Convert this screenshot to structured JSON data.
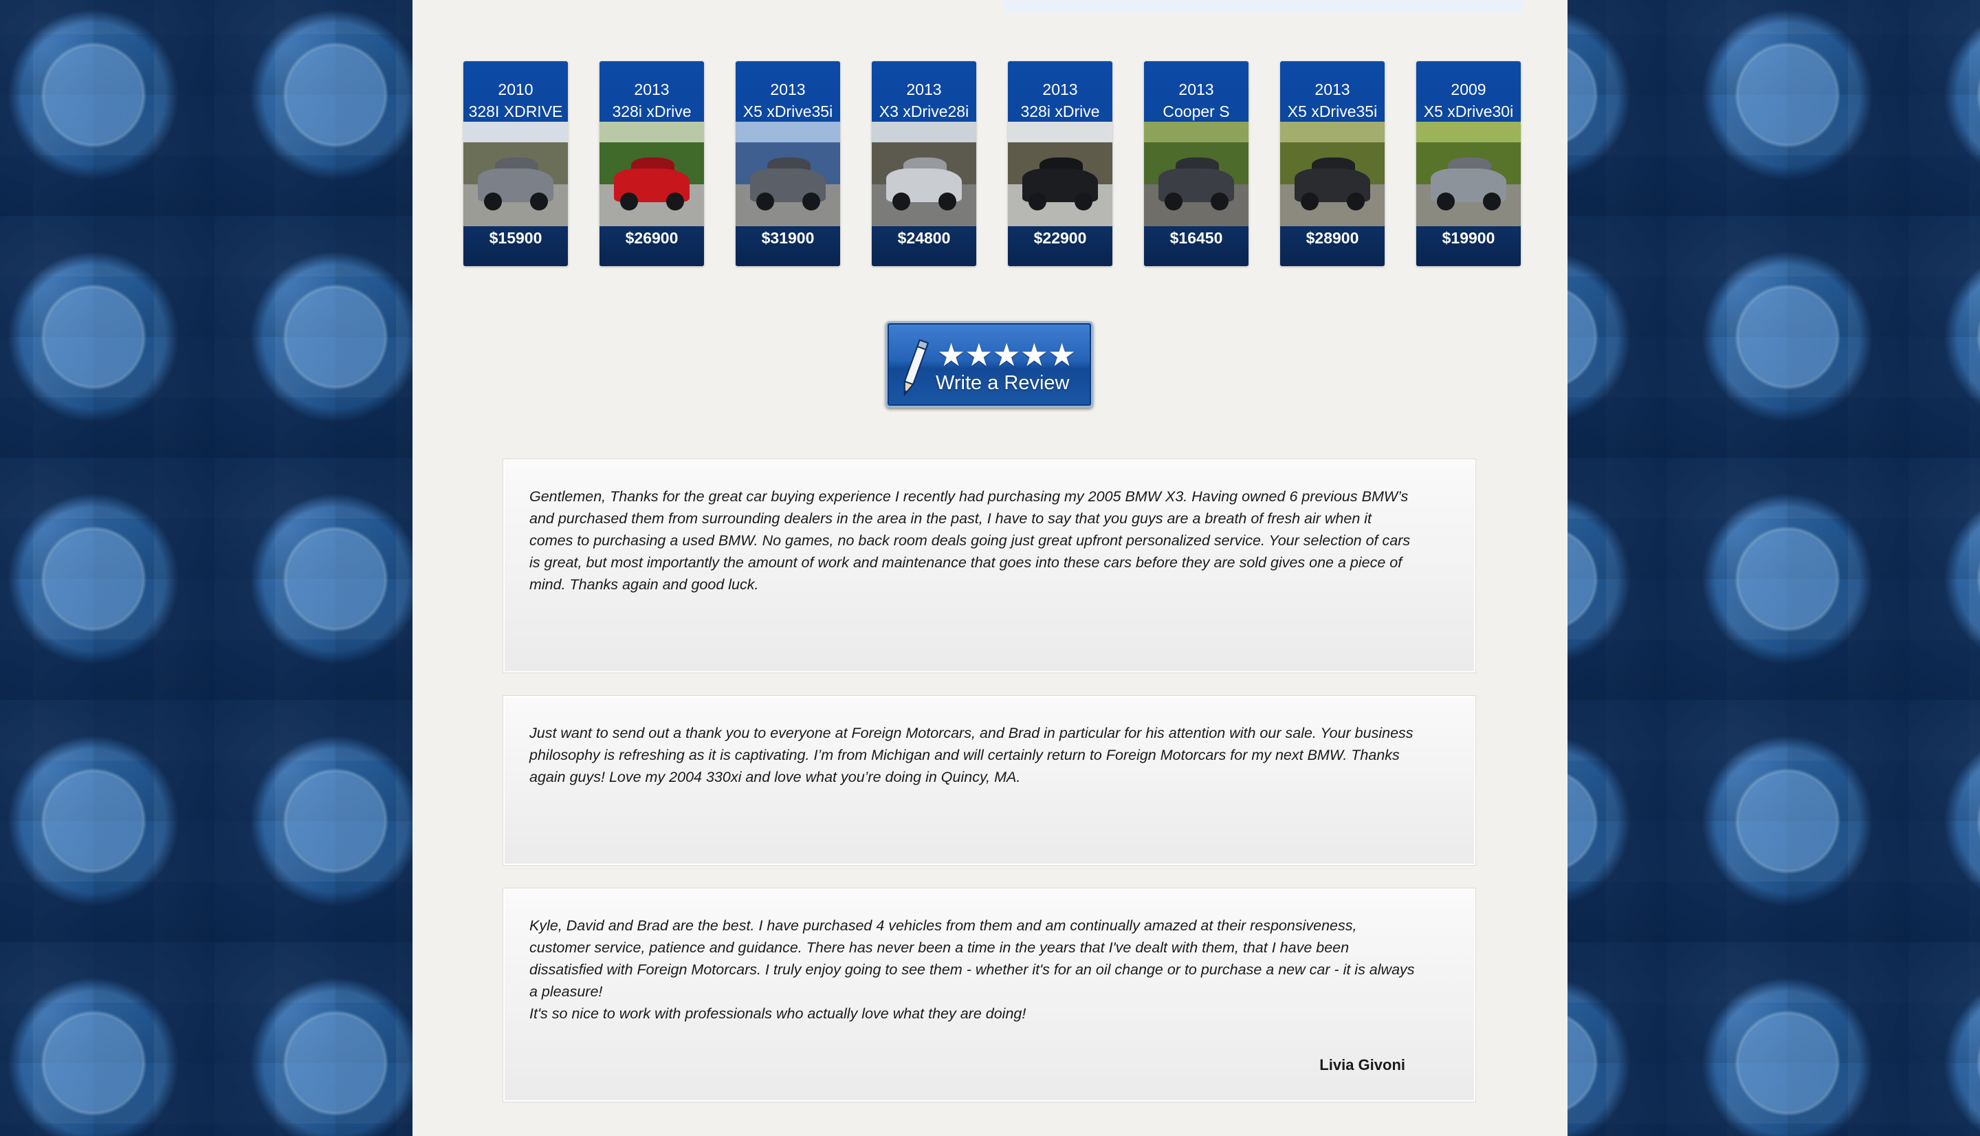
{
  "inventory": [
    {
      "year": "2010",
      "model": "328I XDRIVE",
      "price": "$15900",
      "colors": {
        "body": "#7c8088",
        "sky": "#d7dde6",
        "trees": "#6b6f57",
        "ground": "#9a9c95"
      }
    },
    {
      "year": "2013",
      "model": "328i xDrive",
      "price": "$26900",
      "colors": {
        "body": "#c8161d",
        "sky": "#b9c9a8",
        "trees": "#3f6a2a",
        "ground": "#a8a8a4"
      }
    },
    {
      "year": "2013",
      "model": "X5 xDrive35i",
      "price": "$31900",
      "colors": {
        "body": "#5a5f68",
        "sky": "#9fb9dd",
        "trees": "#3e5f8f",
        "ground": "#8d8e8c"
      }
    },
    {
      "year": "2013",
      "model": "X3 xDrive28i",
      "price": "$24800",
      "colors": {
        "body": "#c9ccd1",
        "sky": "#cbd2d8",
        "trees": "#5c5a4e",
        "ground": "#7b7c7a"
      }
    },
    {
      "year": "2013",
      "model": "328i xDrive",
      "price": "$22900",
      "colors": {
        "body": "#1b1d21",
        "sky": "#dcdfe2",
        "trees": "#5e5b4a",
        "ground": "#b7b7b4"
      }
    },
    {
      "year": "2013",
      "model": "Cooper S",
      "price": "$16450",
      "colors": {
        "body": "#3b3e44",
        "sky": "#8ea35a",
        "trees": "#4d6b2a",
        "ground": "#6f6e68"
      }
    },
    {
      "year": "2013",
      "model": "X5 xDrive35i",
      "price": "$28900",
      "colors": {
        "body": "#2a2c30",
        "sky": "#a3ad6e",
        "trees": "#5f6f2e",
        "ground": "#8c8a7e"
      }
    },
    {
      "year": "2009",
      "model": "X5 xDrive30i",
      "price": "$19900",
      "colors": {
        "body": "#8d939b",
        "sky": "#9db35a",
        "trees": "#58742a",
        "ground": "#8b8a80"
      }
    }
  ],
  "review_button": {
    "stars": "★★★★★",
    "label": "Write a Review"
  },
  "testimonials": [
    {
      "text": "Gentlemen, Thanks for the great car buying experience I recently had purchasing my 2005 BMW X3. Having owned 6 previous BMW’s\nand purchased them from surrounding dealers in the area in the past, I have to say that you guys are a breath of fresh air when it\ncomes to purchasing a used BMW. No games, no back room deals going just great upfront personalized service. Your selection of cars\nis great, but most importantly the amount of work and maintenance that goes into these cars before they are sold gives one a piece of\nmind. Thanks again and good luck.",
      "author": ""
    },
    {
      "text": "Just want to send out a thank you to everyone at Foreign Motorcars, and Brad in particular for his attention with our sale. Your business\nphilosophy is refreshing as it is captivating. I’m from Michigan and will certainly return to Foreign Motorcars for my next BMW. Thanks\nagain guys! Love my 2004 330xi and love what you’re doing in Quincy, MA.",
      "author": ""
    },
    {
      "text": "Kyle, David and Brad are the best. I have purchased 4 vehicles from them and am continually amazed at their responsiveness,\ncustomer service, patience and guidance. There has never been a time in the years that I've dealt with them, that I have been\ndissatisfied with Foreign Motorcars. I truly enjoy going to see them - whether it's for an oil change or to purchase a new car - it is always\na pleasure!\nIt's so nice to work with professionals who actually love what they are doing!",
      "author": "Livia Givoni"
    }
  ]
}
